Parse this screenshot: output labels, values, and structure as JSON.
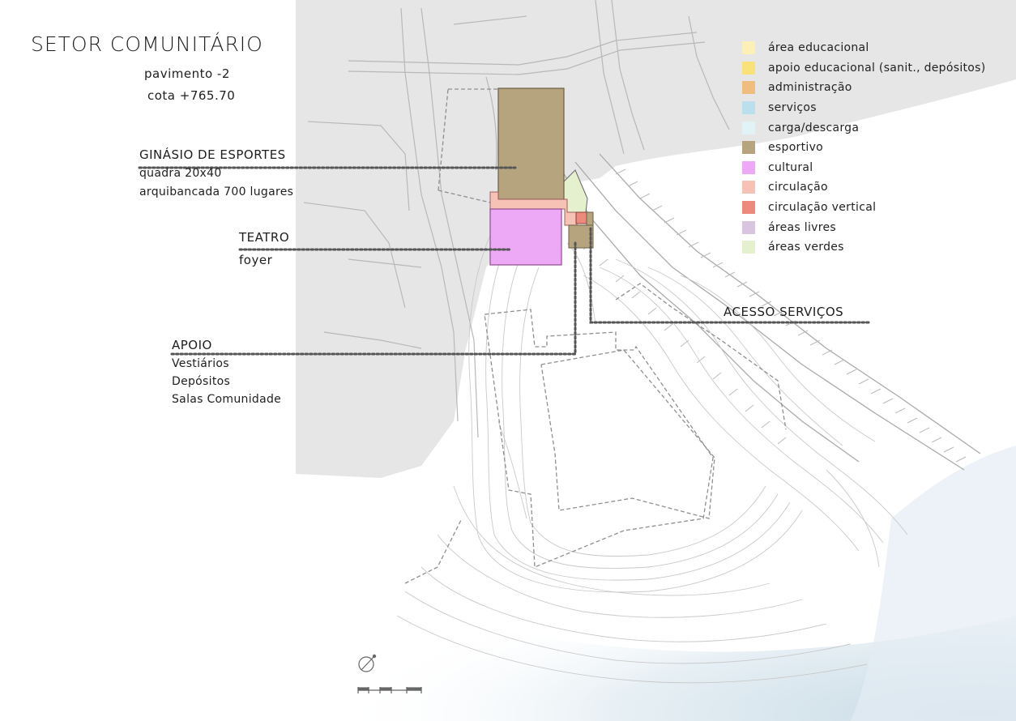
{
  "header": {
    "title": "SETOR COMUNITÁRIO",
    "floor": "pavimento -2",
    "elevation": "cota +765.70"
  },
  "callouts": {
    "ginasio": {
      "title": "GINÁSIO DE ESPORTES",
      "line1": "quadra 20x40",
      "line2": "arquibancada 700 lugares"
    },
    "teatro": {
      "title": "TEATRO",
      "line1": "foyer"
    },
    "apoio": {
      "title": "APOIO",
      "line1": "Vestiários",
      "line2": "Depósitos",
      "line3": "Salas Comunidade"
    },
    "acesso": {
      "title": "ACESSO SERVIÇOS"
    }
  },
  "legend": {
    "items": [
      {
        "label": "área educacional",
        "color": "#fcf0b8"
      },
      {
        "label": "apoio educacional (sanit., depósitos)",
        "color": "#f9e27a"
      },
      {
        "label": "administração",
        "color": "#efbd7e"
      },
      {
        "label": "serviços",
        "color": "#b9e0ec"
      },
      {
        "label": "carga/descarga",
        "color": "#e2f3f8"
      },
      {
        "label": "esportivo",
        "color": "#b5a47e"
      },
      {
        "label": "cultural",
        "color": "#eda8f6"
      },
      {
        "label": "circulação",
        "color": "#f7c2b6"
      },
      {
        "label": "circulação vertical",
        "color": "#ec8a7e"
      },
      {
        "label": "áreas livres",
        "color": "#d9c5df"
      },
      {
        "label": "áreas verdes",
        "color": "#e5f0cf"
      }
    ]
  },
  "map": {
    "icons": [
      "north-arrow-icon",
      "scale-bar-icon"
    ]
  }
}
